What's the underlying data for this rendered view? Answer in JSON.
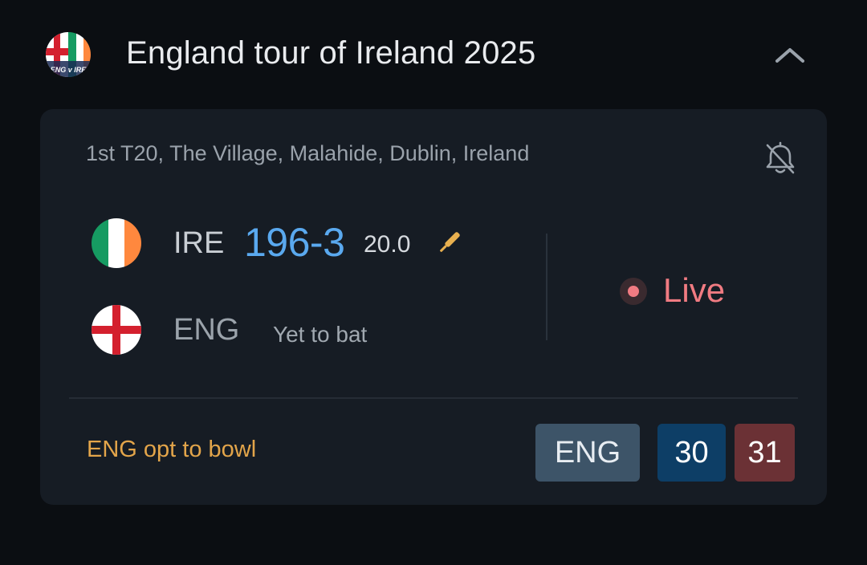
{
  "header": {
    "series_title": "England tour of Ireland 2025",
    "logo_text": "ENG v IRE",
    "logo_icon": "series-logo-icon",
    "collapse_icon": "chevron-up-icon"
  },
  "match": {
    "info": "1st T20, The Village, Malahide, Dublin, Ireland",
    "bell_icon": "bell-off-icon",
    "status": "Live",
    "status_color": "#f07b82",
    "teams": [
      {
        "abbr": "IRE",
        "score": "196-3",
        "overs": "20.0",
        "batting": true,
        "flag_icon": "ireland-flag-icon"
      },
      {
        "abbr": "ENG",
        "note": "Yet to bat",
        "flag_icon": "england-flag-icon"
      }
    ],
    "toss": "ENG opt to bowl",
    "toss_color": "#e3a54a",
    "score_color": "#5aa9ef",
    "pills": {
      "team": "ENG",
      "value1": "30",
      "value2": "31"
    }
  }
}
